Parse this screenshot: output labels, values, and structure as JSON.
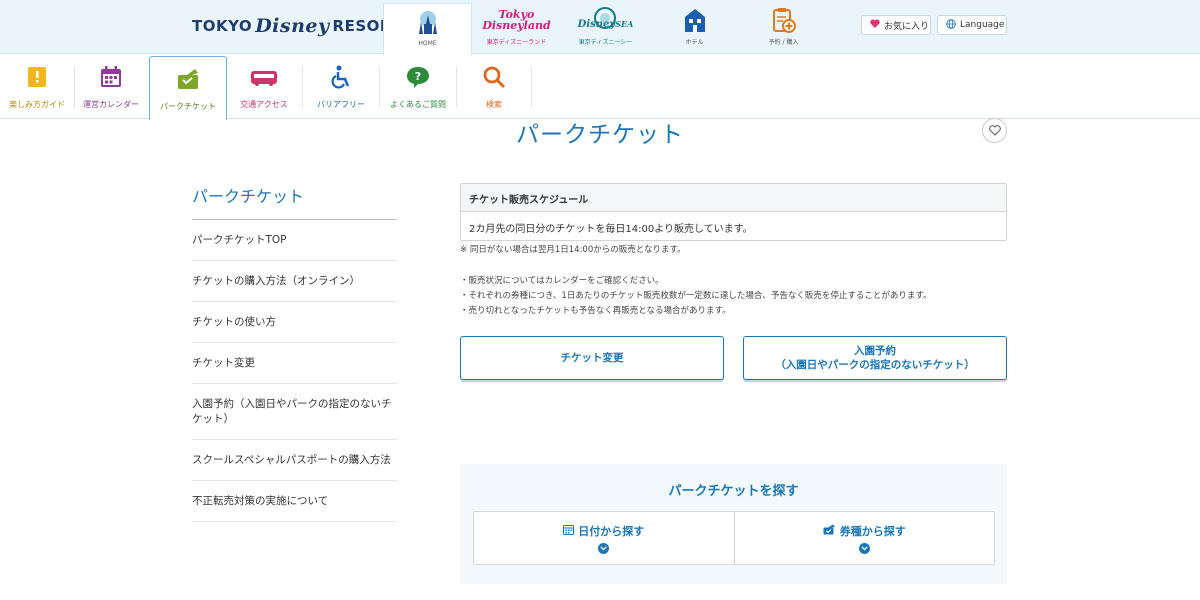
{
  "header": {
    "logo_left": "TOKYO",
    "logo_script": "Disney",
    "logo_right": "RESORT",
    "logo_reg": "®",
    "park_tabs": [
      {
        "label": "HOME",
        "icon": "castle-icon"
      },
      {
        "label": "東京ディズニーランド",
        "brand_line1": "Tokyo",
        "brand_line2": "Disneyland",
        "icon": "tokyo-disneyland-logo"
      },
      {
        "label": "東京ディズニーシー",
        "brand_line1": "Disney",
        "brand_line2": "SEA",
        "icon": "tokyo-disneysea-logo"
      },
      {
        "label": "ホテル",
        "icon": "hotel-icon"
      },
      {
        "label": "予約 / 購入",
        "icon": "clipboard-plus-icon"
      }
    ],
    "favorite_label": "お気に入り",
    "language_label": "Language"
  },
  "subnav": {
    "items": [
      {
        "label": "楽しみ方ガイド",
        "color": "#b8860b",
        "icon": "guide-icon"
      },
      {
        "label": "運営カレンダー",
        "color": "#8e3a96",
        "icon": "calendar-icon"
      },
      {
        "label": "パークチケット",
        "color": "#5a7d1e",
        "icon": "ticket-icon"
      },
      {
        "label": "交通アクセス",
        "color": "#d0336b",
        "icon": "train-icon"
      },
      {
        "label": "バリアフリー",
        "color": "#1565c0",
        "icon": "wheelchair-icon"
      },
      {
        "label": "よくあるご質問",
        "color": "#2e8b3a",
        "icon": "question-icon"
      },
      {
        "label": "検索",
        "color": "#e0661f",
        "icon": "search-icon"
      }
    ]
  },
  "page": {
    "title": "パークチケット"
  },
  "sidebar": {
    "title": "パークチケット",
    "items": [
      {
        "label": "パークチケットTOP"
      },
      {
        "label": "チケットの購入方法（オンライン）"
      },
      {
        "label": "チケットの使い方"
      },
      {
        "label": "チケット変更"
      },
      {
        "label": "入園予約（入園日やパークの指定のないチケット）"
      },
      {
        "label": "スクールスペシャルパスポートの購入方法"
      },
      {
        "label": "不正転売対策の実施について"
      }
    ]
  },
  "schedule": {
    "heading": "チケット販売スケジュール",
    "body": "2カ月先の同日分のチケットを毎日14:00より販売しています。",
    "note_star": "※ 同日がない場合は翌月1日14:00からの販売となります。",
    "bullets": [
      "・販売状況についてはカレンダーをご確認ください。",
      "・それぞれの券種につき、1日あたりのチケット販売枚数が一定数に達した場合、予告なく販売を停止することがあります。",
      "・売り切れとなったチケットも予告なく再販売となる場合があります。"
    ]
  },
  "actions": {
    "change_label": "チケット変更",
    "reserve_line1": "入園予約",
    "reserve_line2": "（入園日やパークの指定のないチケット）"
  },
  "find": {
    "title": "パークチケットを探す",
    "by_date": "日付から探す",
    "by_type": "券種から探す"
  },
  "colors": {
    "accent": "#1a76b8",
    "header_bg": "#eaf4fb",
    "find_bg": "#f2f8fc"
  }
}
